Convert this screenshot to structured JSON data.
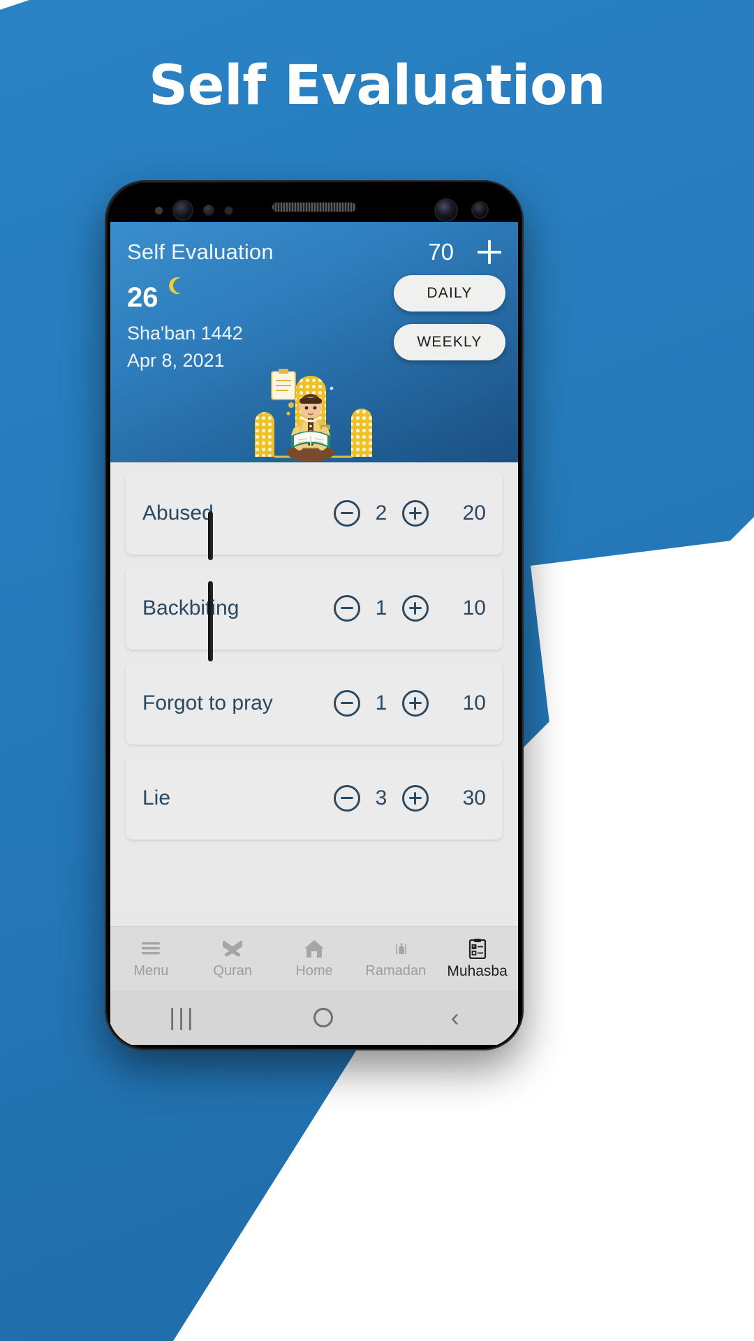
{
  "promo": {
    "title": "Self Evaluation",
    "bg_color": "#2579b9",
    "page_bg": "#ffffff"
  },
  "app": {
    "header": {
      "title": "Self Evaluation",
      "score": "70",
      "add_icon": "plus-icon",
      "hijri_day": "26",
      "moon_icon": "crescent-moon-icon",
      "moon_color": "#f2ce36",
      "hijri_month": "Sha'ban 1442",
      "gregorian_date": "Apr 8, 2021",
      "mode_buttons": [
        {
          "label": "DAILY"
        },
        {
          "label": "WEEKLY"
        }
      ],
      "illustration": "person-reading-quran-illustration",
      "accent_color": "#2e7cbb"
    },
    "list": {
      "decrement_icon": "minus-circle-icon",
      "increment_icon": "plus-circle-icon",
      "text_color": "#2a4963",
      "items": [
        {
          "label": "Abused",
          "count": "2",
          "points": "20"
        },
        {
          "label": "Backbiting",
          "count": "1",
          "points": "10"
        },
        {
          "label": "Forgot to pray",
          "count": "1",
          "points": "10"
        },
        {
          "label": "Lie",
          "count": "3",
          "points": "30"
        }
      ]
    },
    "bottom_nav": [
      {
        "label": "Menu",
        "icon": "hamburger-menu-icon",
        "active": false
      },
      {
        "label": "Quran",
        "icon": "open-quran-icon",
        "active": false
      },
      {
        "label": "Home",
        "icon": "home-icon",
        "active": false
      },
      {
        "label": "Ramadan",
        "icon": "mosque-crescent-icon",
        "active": false
      },
      {
        "label": "Muhasba",
        "icon": "checklist-icon",
        "active": true
      }
    ],
    "system_bar": {
      "recent_icon": "|||",
      "home_icon": "home-circle-icon",
      "back_icon": "‹"
    }
  }
}
